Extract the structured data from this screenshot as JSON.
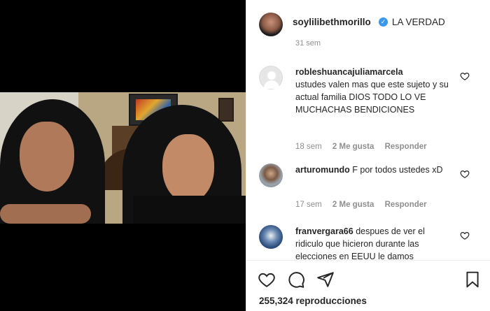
{
  "post": {
    "author": "soylilibethmorillo",
    "caption": "LA VERDAD",
    "time": "31 sem"
  },
  "comments": [
    {
      "user": "robleshuancajuliamarcela",
      "text": "ustudes valen mas que este sujeto y su actual familia DIOS TODO LO VE MUCHACHAS BENDICIONES",
      "time": "18 sem",
      "likes": "2 Me gusta",
      "reply": "Responder"
    },
    {
      "user": "arturomundo",
      "text": "F por todos ustedes xD",
      "time": "17 sem",
      "likes": "2 Me gusta",
      "reply": "Responder"
    },
    {
      "user": "franvergara66",
      "text": "despues de ver el ridiculo que hicieron durante las elecciones en EEUU le damos",
      "time": "",
      "likes": "",
      "reply": ""
    }
  ],
  "stats": {
    "views": "255,324 reproducciones"
  },
  "icons": {
    "like": "heart-icon",
    "comment": "comment-icon",
    "share": "share-icon",
    "save": "bookmark-icon",
    "verified": "verified-badge-icon"
  },
  "colors": {
    "verified": "#3897f0",
    "secondary_text": "#8e8e8e",
    "primary_text": "#262626"
  }
}
